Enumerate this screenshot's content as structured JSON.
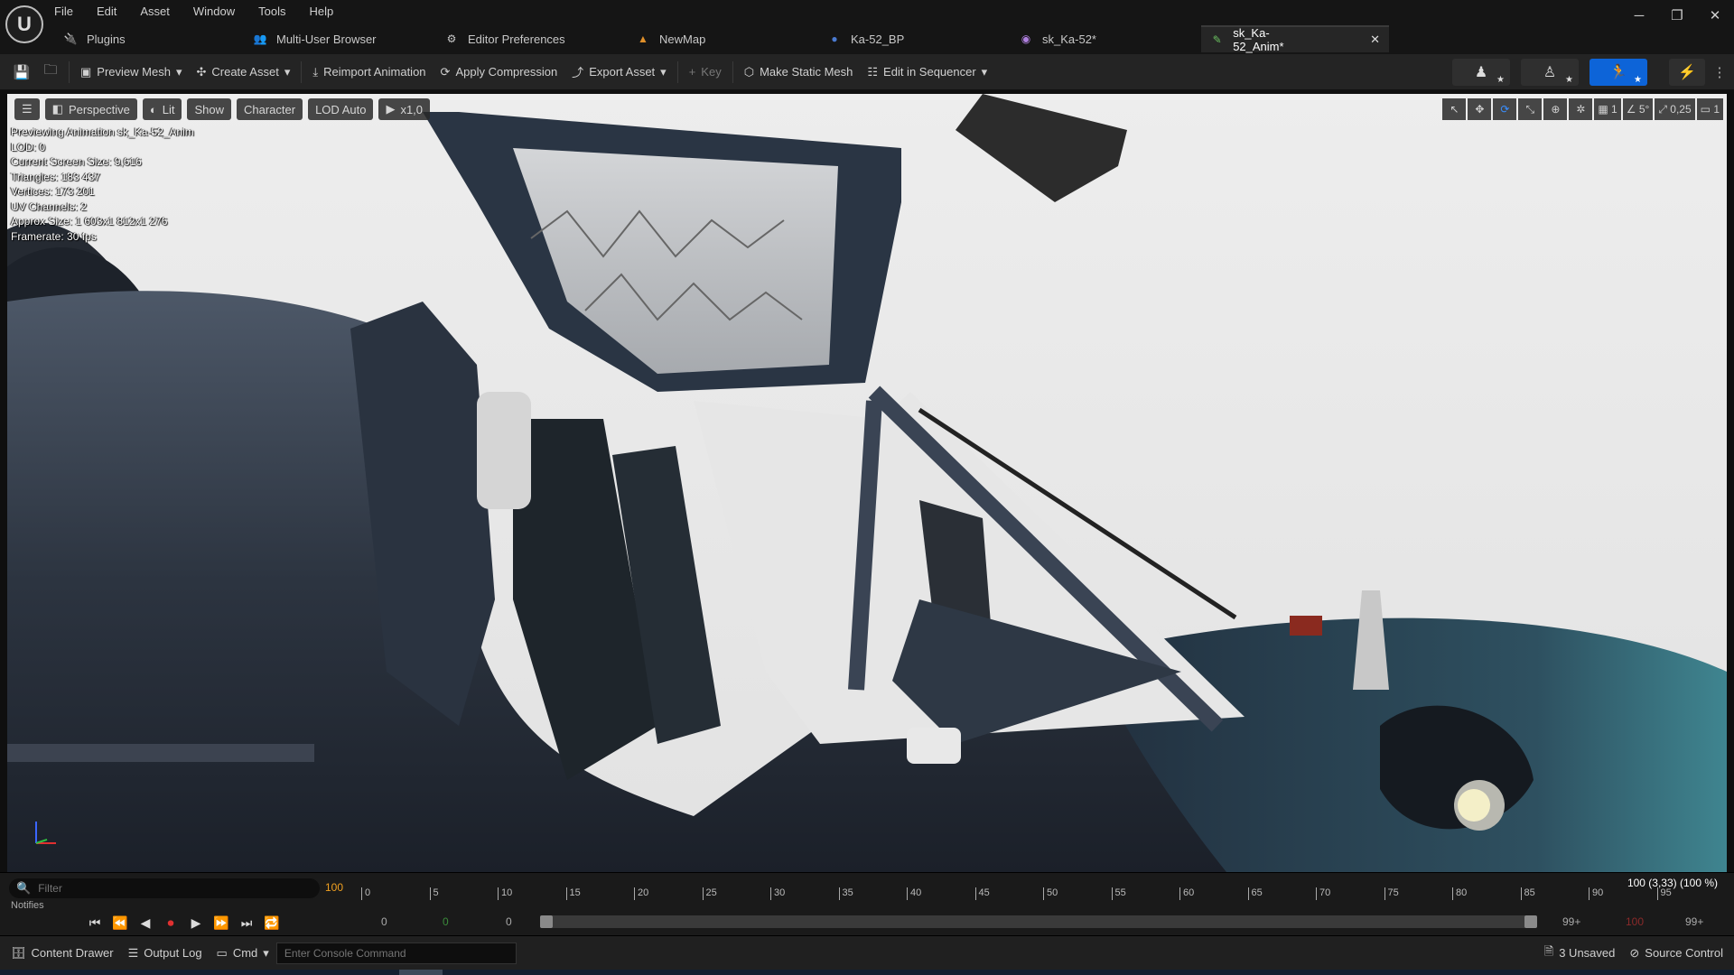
{
  "menu": [
    "File",
    "Edit",
    "Asset",
    "Window",
    "Tools",
    "Help"
  ],
  "logo_text": "U",
  "window_controls": {
    "minimize": "─",
    "restore": "❐",
    "close": "✕"
  },
  "tabs": [
    {
      "label": "Plugins",
      "icon": "plug-icon"
    },
    {
      "label": "Multi-User Browser",
      "icon": "multi-user-icon"
    },
    {
      "label": "Editor Preferences",
      "icon": "sliders-icon"
    },
    {
      "label": "NewMap",
      "icon": "map-icon"
    },
    {
      "label": "Ka-52_BP",
      "icon": "blueprint-icon"
    },
    {
      "label": "sk_Ka-52*",
      "icon": "skeleton-icon"
    },
    {
      "label": "sk_Ka-52_Anim*",
      "icon": "animation-icon",
      "active": true
    }
  ],
  "toolbar": {
    "preview_mesh": "Preview Mesh",
    "create_asset": "Create Asset",
    "reimport_animation": "Reimport Animation",
    "apply_compression": "Apply Compression",
    "export_asset": "Export Asset",
    "key": "Key",
    "make_static_mesh": "Make Static Mesh",
    "edit_in_sequencer": "Edit in Sequencer"
  },
  "viewport": {
    "perspective": "Perspective",
    "lit": "Lit",
    "show": "Show",
    "character": "Character",
    "lod": "LOD Auto",
    "speed": "x1,0",
    "grid_value": "1",
    "angle_value": "5°",
    "scale_value": "0,25",
    "camera_speed": "1"
  },
  "stats": [
    "Previewing Animation sk_Ka-52_Anim",
    "LOD: 0",
    "Current Screen Size: 9,616",
    "Triangles: 183 437",
    "Vertices: 173 201",
    "UV Channels: 2",
    "Approx Size: 1 603x1 812x1 276",
    "Framerate: 30 fps"
  ],
  "timeline": {
    "filter_placeholder": "Filter",
    "filter_count": "100",
    "notifies_label": "Notifies",
    "ticks": [
      "0",
      "5",
      "10",
      "15",
      "20",
      "25",
      "30",
      "35",
      "40",
      "45",
      "50",
      "55",
      "60",
      "65",
      "70",
      "75",
      "80",
      "85",
      "90",
      "95"
    ],
    "frame_info": "100 (3,33) (100 %)",
    "start_a": "0",
    "start_b": "0",
    "start_c": "0",
    "end_a": "99+",
    "end_b": "100",
    "end_c": "99+"
  },
  "bottombar": {
    "content_drawer": "Content Drawer",
    "output_log": "Output Log",
    "cmd": "Cmd",
    "console_placeholder": "Enter Console Command",
    "unsaved": "3 Unsaved",
    "source_control": "Source Control"
  },
  "colors": {
    "accent": "#0d64d8",
    "record": "#e03030",
    "frame_count": "#f0a020"
  }
}
